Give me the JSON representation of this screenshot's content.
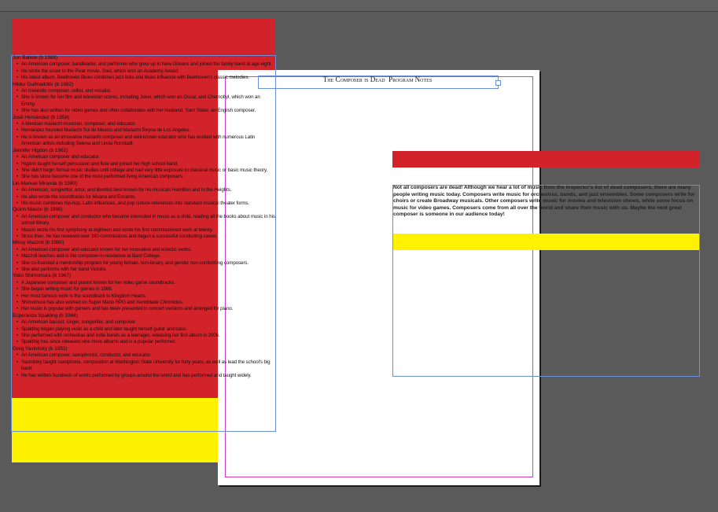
{
  "document": {
    "title": "The Composer is Dead  Program Notes",
    "intro": "Not all composers are dead! Although we hear a lot of music from the inspector's list of dead composers, there are many people writing music today. Composers write music for orchestras, bands, and jazz ensembles. Some composers write for choirs or create Broadway musicals. Other composers write music for movies and television shows, while some focus on music for video games. Composers come from all over the world and share their music with us. Maybe the next great composer is someone in our audience today!"
  },
  "composers": [
    {
      "name": "Jon Batiste (b 1986)",
      "facts": [
        "An American composer, bandleader, and performer who grew up in New Orleans and joined the family band at age eight.",
        "He wrote the score to the Pixar movie, Soul, which won an Academy Award.",
        "His latest album, Beethoven Blues combines jazz licks and blues influence with Beethoven's classic melodies."
      ]
    },
    {
      "name": "Hildur Guðnadóttir (b 1982)",
      "facts": [
        "An Icelandic composer, cellist, and vocalist.",
        "She is known for her film and television scores, including Joker, which won an Oscar, and Chernobyl, which won an Emmy.",
        "She has also written for video games and often collaborates with her husband, Sam Slater, an English composer."
      ]
    },
    {
      "name": "José Hernández (b 1958)",
      "facts": [
        "A Mexican mariachi musician, composer, and educator.",
        "Hernández founded Mariachi Sol de Mexico and Mariachi Reyna de Los Angeles.",
        "He is known as an innovative mariachi composer and well-known educator who has worked with numerous Latin American artists including Selena and Linda Ronstadt."
      ]
    },
    {
      "name": "Jennifer Higdon (b 1962)",
      "facts": [
        "An American composer and educator.",
        "Higdon taught herself percussion and flute and joined her high school band.",
        "She didn't begin formal music studies until college and had very little exposure to classical music or basic music theory.",
        "She has since become one of the most performed living American composers."
      ]
    },
    {
      "name": "Lin-Manuel Miranda (b 1980)",
      "facts": [
        "An American, songwriter, actor, and librettist best known for his musicals Hamilton and In the Heights.",
        "He also wrote the soundtracks for Moana and Encanto.",
        "His music combines hip-hop, Latin influences, and pop culture references into standard musical theater forms."
      ]
    },
    {
      "name": "Quinn Mason (b 1996)",
      "facts": [
        "An American composer and conductor who became interested in music as a child, reading all the books about music in his school library.",
        "Mason wrote his first symphony at eighteen and wrote his first commissioned work at twenty.",
        "Since then, he has received over 160 commissions and begun a successful conducting career."
      ]
    },
    {
      "name": "Missy Mazzoli (b 1980)",
      "facts": [
        "An American composer and educator known for her innovative and eclectic works.",
        "Mazzoli teaches and is the composer-in-residence at Bard College.",
        "She co-founded a mentorship program for young female, non-binary, and gender non-conforming composers.",
        "She also performs with her band Victoire."
      ]
    },
    {
      "name": "Yoko Shimomura (b 1967)",
      "facts": [
        "A Japanese composer and pianist known for her video game soundtracks.",
        "She began writing music for games in 1988.",
        "Her most famous work is the soundtrack to Kingdom Hearts.",
        "Shimomura has also worked on Super Mario RPG and Xenoblade Chronicles.",
        "Her music is popular with gamers and has been presented in concert versions and arranged for piano."
      ]
    },
    {
      "name": "Esperanza Spalding (b 1984)",
      "facts": [
        "An American bassist, singer, songwriter, and composer.",
        "Spalding began playing violin as a child and later taught herself guitar and bass.",
        "She performed with orchestras and indie bands as a teenager, releasing her first album in 2006.",
        "Spalding has since released nine more albums and is a popular performer."
      ]
    },
    {
      "name": "Greg Yasinitsky (b 1953)",
      "facts": [
        "An American composer, saxophonist, conductor, and educator.",
        "Yasinitsky taught saxophone, composition at Washington State University for forty years, as well as lead the school's big band.",
        "He has written hundreds of works performed by groups around the world and has performed and taught widely."
      ]
    }
  ],
  "colors": {
    "accent_red": "#d2232a",
    "accent_yellow": "#fff200",
    "frame_blue": "#6a8fd6",
    "guide_magenta": "#d13cd1",
    "pasteboard": "#5a5a5a"
  }
}
